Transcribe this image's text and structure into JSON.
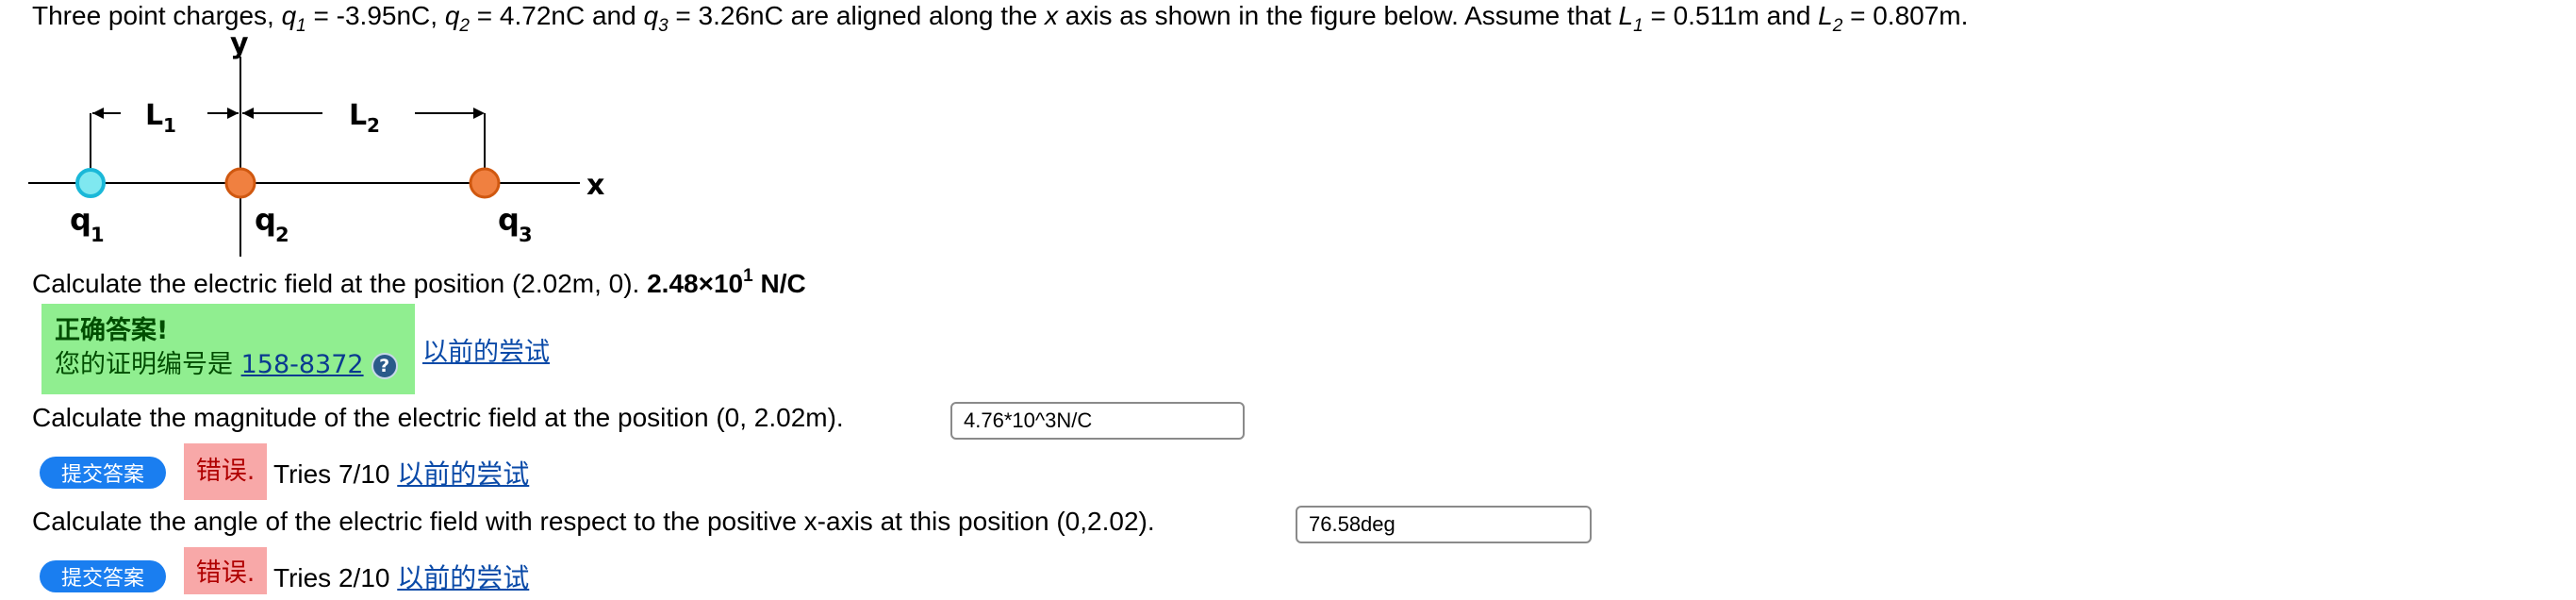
{
  "problem": {
    "intro_prefix": "Three point charges, ",
    "q1_var": "q",
    "q1_sub": "1",
    "q1_val": " = -3.95nC, ",
    "q2_var": "q",
    "q2_sub": "2",
    "q2_val": " = 4.72nC and ",
    "q3_var": "q",
    "q3_sub": "3",
    "q3_val": " = 3.26nC are aligned along the ",
    "x_var": "x",
    "mid_text": " axis as shown in the figure below. Assume that ",
    "L1_var": "L",
    "L1_sub": "1",
    "L1_val": " = 0.511m and ",
    "L2_var": "L",
    "L2_sub": "2",
    "L2_val": " = 0.807m."
  },
  "figure": {
    "y_label": "y",
    "x_label": "x",
    "L1_label": "L",
    "L1_sub": "1",
    "L2_label": "L",
    "L2_sub": "2",
    "q1_label": "q",
    "q1_sub": "1",
    "q2_label": "q",
    "q2_sub": "2",
    "q3_label": "q",
    "q3_sub": "3",
    "colors": {
      "q1_fill": "#7fe8f0",
      "q1_ring": "#1ab8d8",
      "q_orange": "#f08040",
      "q_orange_ring": "#d05810"
    }
  },
  "part1": {
    "question": "Calculate the electric field at the position (2.02m, 0). ",
    "answer_base": "2.48×10",
    "answer_exp": "1",
    "answer_unit": " N/C",
    "correct_title": "正确答案!",
    "receipt_label": "您的证明编号是 ",
    "receipt_number": "158-8372",
    "help_icon": "?",
    "previous_link": "以前的尝试"
  },
  "part2": {
    "question": "Calculate the magnitude of the electric field at the position (0, 2.02m).",
    "input_value": "4.76*10^3N/C",
    "submit_label": "提交答案",
    "error_label": "错误.",
    "tries": "Tries 7/10",
    "previous_link": "以前的尝试"
  },
  "part3": {
    "question": "Calculate the angle of the electric field with respect to the positive x-axis at this position (0,2.02).",
    "input_value": "76.58deg",
    "submit_label": "提交答案",
    "error_label": "错误.",
    "tries": "Tries 2/10",
    "previous_link": "以前的尝试"
  }
}
